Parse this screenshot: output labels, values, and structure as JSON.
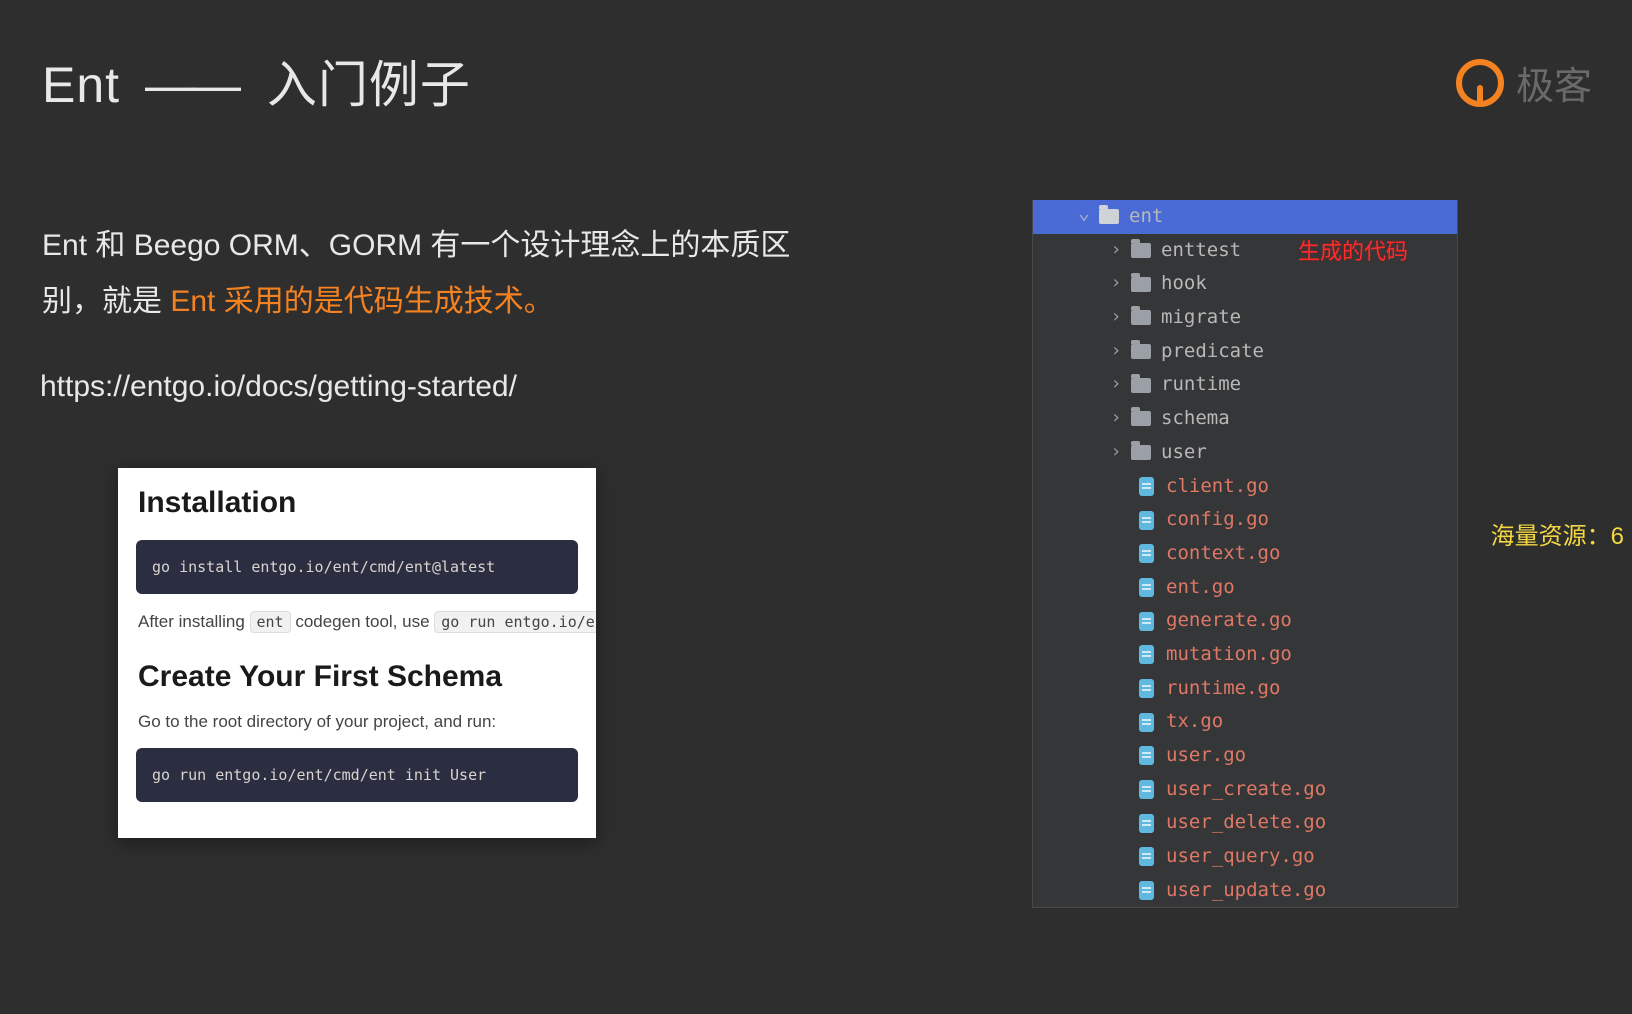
{
  "title_prefix": "Ent",
  "title_suffix": "入门例子",
  "logo_text": "极客",
  "paragraph_pre": "Ent 和 Beego ORM、GORM 有一个设计理念上的本质区别，就是 ",
  "paragraph_highlight": "Ent 采用的是代码生成技术。",
  "doc_link": "https://entgo.io/docs/getting-started/",
  "doc": {
    "h1": "Installation",
    "code1": "go install entgo.io/ent/cmd/ent@latest",
    "after_install_1": "After installing ",
    "after_install_code1": "ent",
    "after_install_2": " codegen tool, use ",
    "after_install_code2": "go run entgo.io/e",
    "h2": "Create Your First Schema",
    "schema_text": "Go to the root directory of your project, and run:",
    "code2": "go run entgo.io/ent/cmd/ent init User"
  },
  "tree": {
    "root": "ent",
    "folders": [
      "enttest",
      "hook",
      "migrate",
      "predicate",
      "runtime",
      "schema",
      "user"
    ],
    "files": [
      "client.go",
      "config.go",
      "context.go",
      "ent.go",
      "generate.go",
      "mutation.go",
      "runtime.go",
      "tx.go",
      "user.go",
      "user_create.go",
      "user_delete.go",
      "user_query.go",
      "user_update.go"
    ]
  },
  "annotation": "生成的代码",
  "watermark": "海量资源：6"
}
